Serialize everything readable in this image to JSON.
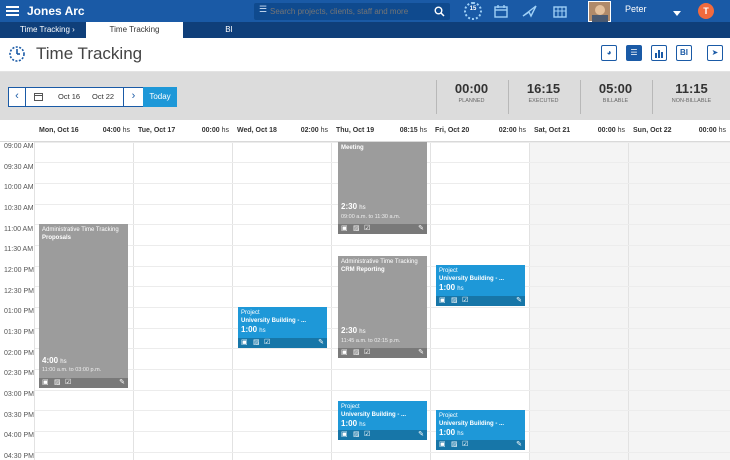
{
  "topbar": {
    "app_title": "Jones Arc",
    "search_placeholder": "Search projects, clients, staff and more",
    "user_name": "Peter",
    "timer_badge": "15"
  },
  "tabs": [
    {
      "label": "Time Tracking"
    },
    {
      "label": "Time Tracking"
    },
    {
      "label": "BI"
    }
  ],
  "header": {
    "title": "Time Tracking",
    "bi_label": "BI"
  },
  "nav": {
    "start": "Oct 16",
    "end": "Oct 22",
    "today": "Today"
  },
  "summary": [
    {
      "value": "00:00",
      "label": "PLANNED"
    },
    {
      "value": "16:15",
      "label": "EXECUTED"
    },
    {
      "value": "05:00",
      "label": "BILLABLE"
    },
    {
      "value": "11:15",
      "label": "NON-BILLABLE"
    }
  ],
  "days": [
    {
      "name": "Mon, Oct 16",
      "hours": "04:00",
      "unit": "hs"
    },
    {
      "name": "Tue, Oct 17",
      "hours": "00:00",
      "unit": "hs"
    },
    {
      "name": "Wed, Oct 18",
      "hours": "02:00",
      "unit": "hs"
    },
    {
      "name": "Thu, Oct 19",
      "hours": "08:15",
      "unit": "hs"
    },
    {
      "name": "Fri, Oct 20",
      "hours": "02:00",
      "unit": "hs"
    },
    {
      "name": "Sat, Oct 21",
      "hours": "00:00",
      "unit": "hs"
    },
    {
      "name": "Sun, Oct 22",
      "hours": "00:00",
      "unit": "hs"
    }
  ],
  "times": [
    "09:00 AM",
    "09:30 AM",
    "10:00 AM",
    "10:30 AM",
    "11:00 AM",
    "11:30 AM",
    "12:00 PM",
    "12:30 PM",
    "01:00 PM",
    "01:30 PM",
    "02:00 PM",
    "02:30 PM",
    "03:00 PM",
    "03:30 PM",
    "04:00 PM",
    "04:30 PM"
  ],
  "events": [
    {
      "category": "Administrative Time Tracking",
      "title": "Proposals",
      "hours": "4:00",
      "unit": "hs",
      "range": "11:00 a.m. to 03:00 p.m.",
      "color": "#9c9c9c"
    },
    {
      "category": "Project",
      "title": "University Building - ...",
      "hours": "1:00",
      "unit": "hs",
      "range": "",
      "color": "#1e98d8"
    },
    {
      "category": "",
      "title": "Meeting",
      "hours": "2:30",
      "unit": "hs",
      "range": "09:00 a.m. to 11:30 a.m.",
      "color": "#9c9c9c"
    },
    {
      "category": "Administrative Time Tracking",
      "title": "CRM Reporting",
      "hours": "2:30",
      "unit": "hs",
      "range": "11:45 a.m. to 02:15 p.m.",
      "color": "#9c9c9c"
    },
    {
      "category": "Project",
      "title": "University Building - ...",
      "hours": "1:00",
      "unit": "hs",
      "range": "",
      "color": "#1e98d8"
    },
    {
      "category": "Project",
      "title": "University Building - ...",
      "hours": "1:00",
      "unit": "hs",
      "range": "",
      "color": "#1e98d8"
    },
    {
      "category": "Project",
      "title": "University Building - ...",
      "hours": "1:00",
      "unit": "hs",
      "range": "",
      "color": "#1e98d8"
    }
  ]
}
